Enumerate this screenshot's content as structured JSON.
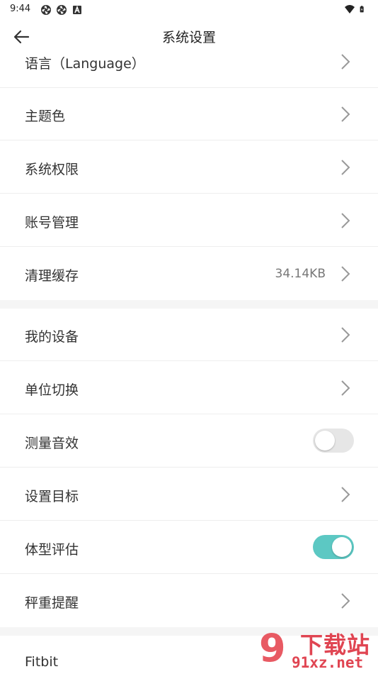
{
  "status": {
    "time": "9:44"
  },
  "header": {
    "title": "系统设置"
  },
  "groups": [
    [
      {
        "label": "语言（Language）",
        "type": "nav"
      },
      {
        "label": "主题色",
        "type": "nav"
      },
      {
        "label": "系统权限",
        "type": "nav"
      },
      {
        "label": "账号管理",
        "type": "nav"
      },
      {
        "label": "清理缓存",
        "type": "nav",
        "value": "34.14KB"
      }
    ],
    [
      {
        "label": "我的设备",
        "type": "nav"
      },
      {
        "label": "单位切换",
        "type": "nav"
      },
      {
        "label": "测量音效",
        "type": "toggle",
        "enabled": false
      },
      {
        "label": "设置目标",
        "type": "nav"
      },
      {
        "label": "体型评估",
        "type": "toggle",
        "enabled": true
      },
      {
        "label": "秤重提醒",
        "type": "nav"
      }
    ],
    [
      {
        "label": "Fitbit",
        "type": "nav"
      }
    ]
  ],
  "watermark": {
    "text": "下载站",
    "url": "91xz.net",
    "logo_glyph": "9"
  },
  "colors": {
    "toggle_on": "#5cc8c3",
    "toggle_off": "#e6e6e6",
    "watermark": "#e04552"
  },
  "icons": {
    "back": "arrow-left-icon",
    "chevron": "chevron-right-icon",
    "status_left": [
      "aperture-icon",
      "aperture-icon",
      "font-a-icon"
    ],
    "status_right": [
      "wifi-icon",
      "battery-charging-icon"
    ]
  }
}
